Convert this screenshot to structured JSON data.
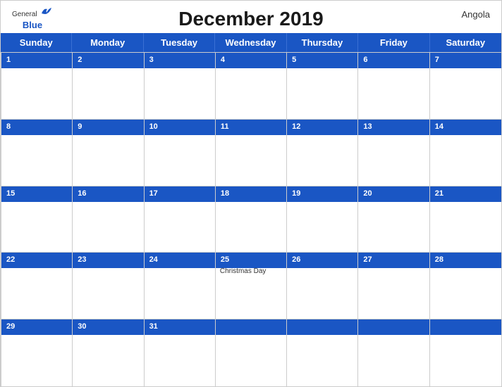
{
  "header": {
    "title": "December 2019",
    "country": "Angola",
    "logo": {
      "general": "General",
      "blue": "Blue"
    }
  },
  "days": [
    "Sunday",
    "Monday",
    "Tuesday",
    "Wednesday",
    "Thursday",
    "Friday",
    "Saturday"
  ],
  "weeks": [
    [
      {
        "date": "1",
        "event": ""
      },
      {
        "date": "2",
        "event": ""
      },
      {
        "date": "3",
        "event": ""
      },
      {
        "date": "4",
        "event": ""
      },
      {
        "date": "5",
        "event": ""
      },
      {
        "date": "6",
        "event": ""
      },
      {
        "date": "7",
        "event": ""
      }
    ],
    [
      {
        "date": "8",
        "event": ""
      },
      {
        "date": "9",
        "event": ""
      },
      {
        "date": "10",
        "event": ""
      },
      {
        "date": "11",
        "event": ""
      },
      {
        "date": "12",
        "event": ""
      },
      {
        "date": "13",
        "event": ""
      },
      {
        "date": "14",
        "event": ""
      }
    ],
    [
      {
        "date": "15",
        "event": ""
      },
      {
        "date": "16",
        "event": ""
      },
      {
        "date": "17",
        "event": ""
      },
      {
        "date": "18",
        "event": ""
      },
      {
        "date": "19",
        "event": ""
      },
      {
        "date": "20",
        "event": ""
      },
      {
        "date": "21",
        "event": ""
      }
    ],
    [
      {
        "date": "22",
        "event": ""
      },
      {
        "date": "23",
        "event": ""
      },
      {
        "date": "24",
        "event": ""
      },
      {
        "date": "25",
        "event": "Christmas Day"
      },
      {
        "date": "26",
        "event": ""
      },
      {
        "date": "27",
        "event": ""
      },
      {
        "date": "28",
        "event": ""
      }
    ],
    [
      {
        "date": "29",
        "event": ""
      },
      {
        "date": "30",
        "event": ""
      },
      {
        "date": "31",
        "event": ""
      },
      {
        "date": "",
        "event": ""
      },
      {
        "date": "",
        "event": ""
      },
      {
        "date": "",
        "event": ""
      },
      {
        "date": "",
        "event": ""
      }
    ]
  ],
  "colors": {
    "header_bg": "#1a56c4",
    "cell_bg": "#ffffff",
    "date_color_light": "#ffffff",
    "border": "#cccccc"
  }
}
